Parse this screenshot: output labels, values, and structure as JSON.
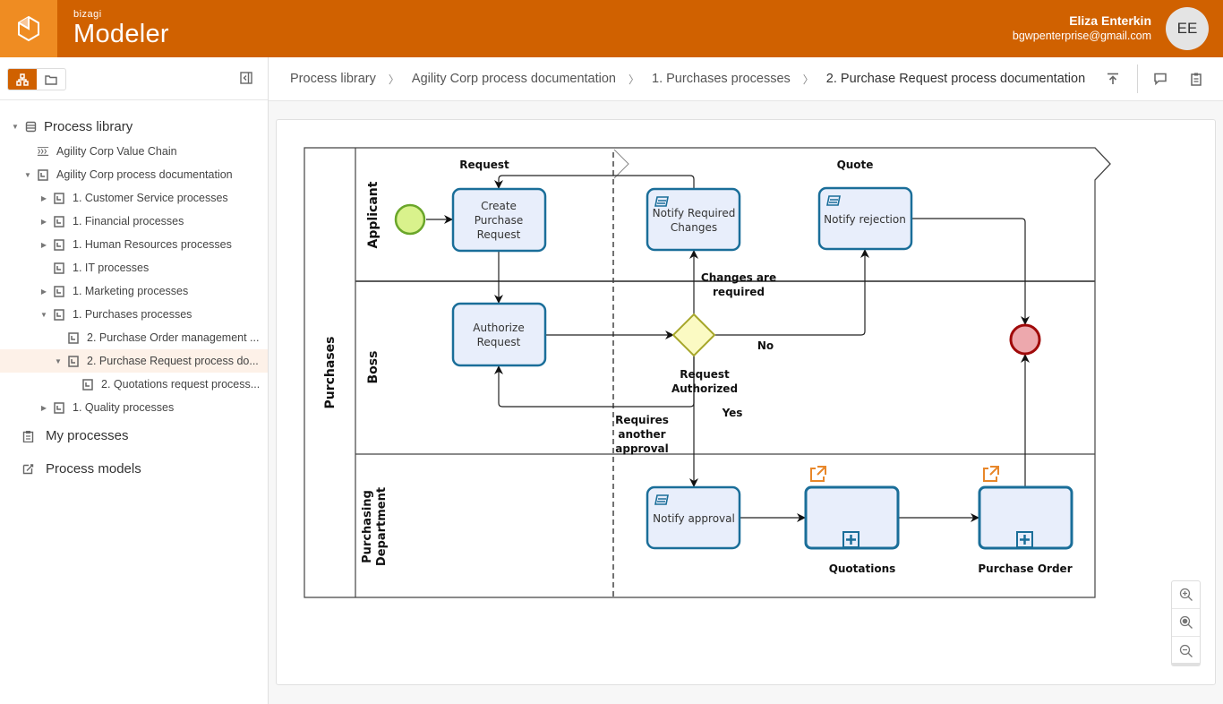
{
  "header": {
    "brand_small": "bizagi",
    "brand_big": "Modeler",
    "user_name": "Eliza Enterkin",
    "user_email": "bgwpenterprise@gmail.com",
    "avatar_initials": "EE",
    "brand_color": "#d06100",
    "logo_color": "#ef8c22"
  },
  "sidebar": {
    "tree": [
      {
        "label": "Process library",
        "icon": "library-icon",
        "caret": "expanded",
        "level": 0
      },
      {
        "label": "Agility Corp Value Chain",
        "icon": "value-chain-icon",
        "caret": "none",
        "level": 1
      },
      {
        "label": "Agility Corp process documentation",
        "icon": "document-icon",
        "caret": "expanded",
        "level": 1
      },
      {
        "label": "1. Customer Service processes",
        "icon": "document-icon",
        "caret": "collapsed",
        "level": 2
      },
      {
        "label": "1. Financial processes",
        "icon": "document-icon",
        "caret": "collapsed",
        "level": 2
      },
      {
        "label": "1. Human Resources processes",
        "icon": "document-icon",
        "caret": "collapsed",
        "level": 2
      },
      {
        "label": "1. IT processes",
        "icon": "document-icon",
        "caret": "none",
        "level": 2
      },
      {
        "label": "1. Marketing processes",
        "icon": "document-icon",
        "caret": "collapsed",
        "level": 2
      },
      {
        "label": "1. Purchases processes",
        "icon": "document-icon",
        "caret": "expanded",
        "level": 2
      },
      {
        "label": "2. Purchase Order management ...",
        "icon": "document-icon",
        "caret": "none",
        "level": 3
      },
      {
        "label": "2. Purchase Request process do...",
        "icon": "document-icon",
        "caret": "expanded",
        "level": 3,
        "selected": true
      },
      {
        "label": "2. Quotations request process...",
        "icon": "document-icon",
        "caret": "none",
        "level": 4
      },
      {
        "label": "1. Quality processes",
        "icon": "document-icon",
        "caret": "collapsed",
        "level": 2
      }
    ],
    "my_processes": "My processes",
    "process_models": "Process models"
  },
  "breadcrumb": [
    "Process library",
    "Agility Corp process documentation",
    "1. Purchases processes",
    "2. Purchase Request process documentation"
  ],
  "diagram": {
    "pool": "Purchases",
    "lanes": [
      "Applicant",
      "Boss",
      "Purchasing Department"
    ],
    "phases": [
      "Request",
      "Quote"
    ],
    "tasks": {
      "create": "Create Purchase Request",
      "authorize": "Authorize Request",
      "notify_changes": "Notify Required Changes",
      "notify_rejection": "Notify rejection",
      "notify_approval": "Notify approval",
      "quotations": "Quotations",
      "purchase_order": "Purchase Order"
    },
    "labels": {
      "changes_required": "Changes are required",
      "no": "No",
      "request_authorized": "Request Authorized",
      "yes": "Yes",
      "requires_another": "Requires another approval"
    },
    "colors": {
      "task_fill": "#e8eefb",
      "task_stroke": "#1a6e99",
      "start_fill": "#d9f28c",
      "start_stroke": "#6aa62a",
      "end_fill": "#eda8ad",
      "end_stroke": "#a00a0a",
      "gateway_fill": "#fbfac3",
      "gateway_stroke": "#a6a62a",
      "link_icon": "#e8872a"
    }
  }
}
